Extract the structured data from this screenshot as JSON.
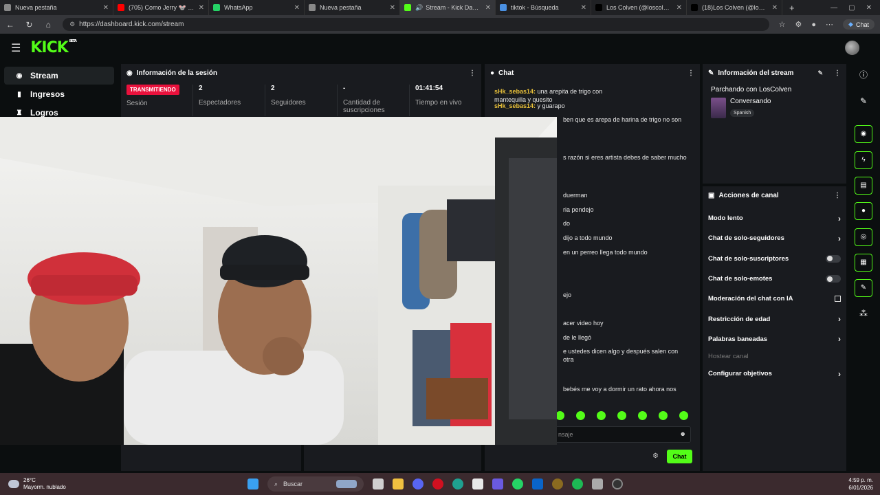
{
  "browser": {
    "tabs": [
      {
        "label": "Nueva pestaña",
        "color": "#888888",
        "audio": false
      },
      {
        "label": "(705) Como Jerry 🐭 (Video",
        "color": "#ff0000",
        "audio": false
      },
      {
        "label": "WhatsApp",
        "color": "#25d366",
        "audio": false
      },
      {
        "label": "Nueva pestaña",
        "color": "#888888",
        "audio": false
      },
      {
        "label": "Stream - Kick Dashboa",
        "color": "#53fc18",
        "audio": true
      },
      {
        "label": "tiktok - Búsqueda",
        "color": "#4a90e2",
        "audio": false
      },
      {
        "label": "Los Colven (@loscolven) es",
        "color": "#000000",
        "audio": false
      },
      {
        "label": "(18)Los Colven (@loscolven",
        "color": "#000000",
        "audio": false
      }
    ],
    "url": "https://dashboard.kick.com/stream",
    "chat_button": "Chat"
  },
  "kick": {
    "logo": "KICK",
    "beta": "BETA"
  },
  "leftnav": {
    "items": [
      {
        "label": "Stream",
        "icon": "broadcast-icon"
      },
      {
        "label": "Ingresos",
        "icon": "bar-chart-icon"
      },
      {
        "label": "Logros",
        "icon": "trophy-icon"
      }
    ]
  },
  "session": {
    "title": "Información de la sesión",
    "live_badge": "TRANSMITIENDO",
    "stats": [
      {
        "value": "",
        "label": "Sesión"
      },
      {
        "value": "2",
        "label": "Espectadores"
      },
      {
        "value": "2",
        "label": "Seguidores"
      },
      {
        "value": "-",
        "label": "Cantidad de suscripciones"
      },
      {
        "value": "01:41:54",
        "label": "Tiempo en vivo"
      }
    ]
  },
  "chat": {
    "title": "Chat",
    "messages": [
      {
        "user": "sHk_sebas14:",
        "text": " una arepita de trigo con mantequilla y quesito"
      },
      {
        "user": "sHk_sebas14:",
        "text": " y guarapo"
      },
      {
        "user": "",
        "text": "ben que es arepa de harina de trigo no son"
      },
      {
        "user": "",
        "text": "s razón si eres artista debes de saber mucho"
      },
      {
        "user": "",
        "text": "duerman"
      },
      {
        "user": "",
        "text": "ria pendejo"
      },
      {
        "user": "",
        "text": "do"
      },
      {
        "user": "",
        "text": "dijo a todo mundo"
      },
      {
        "user": "",
        "text": "en un perreo llega todo mundo"
      },
      {
        "user": "",
        "text": "ejo"
      },
      {
        "user": "",
        "text": "acer video hoy"
      },
      {
        "user": "",
        "text": "de le llegó"
      },
      {
        "user": "",
        "text": "e ustedes dicen algo y después salen con otra"
      },
      {
        "user": "",
        "text": "bebés me voy a dormir un rato ahora nos"
      }
    ],
    "input_placeholder": "nsaje",
    "send_label": "Chat"
  },
  "stream_info": {
    "title": "Información del stream",
    "stream_title": "Parchando con LosColven",
    "category": "Conversando",
    "language": "Spanish"
  },
  "channel_actions": {
    "title": "Acciones de canal",
    "items": [
      {
        "label": "Modo lento",
        "kind": "chevron"
      },
      {
        "label": "Chat de solo-seguidores",
        "kind": "chevron"
      },
      {
        "label": "Chat de solo-suscriptores",
        "kind": "toggle"
      },
      {
        "label": "Chat de solo-emotes",
        "kind": "toggle"
      },
      {
        "label": "Moderación del chat con IA",
        "kind": "external"
      },
      {
        "label": "Restricción de edad",
        "kind": "chevron"
      },
      {
        "label": "Palabras baneadas",
        "kind": "chevron"
      },
      {
        "label": "Hostear canal",
        "kind": "disabled"
      },
      {
        "label": "Configurar objetivos",
        "kind": "chevron"
      }
    ]
  },
  "taskbar": {
    "temp": "26°C",
    "weather": "Mayorm. nublado",
    "search": "Buscar",
    "time": "4:59 p. m.",
    "date": "6/01/2026"
  },
  "colors": {
    "accent": "#53fc18",
    "live": "#e9113c",
    "panel": "#191b1f"
  }
}
